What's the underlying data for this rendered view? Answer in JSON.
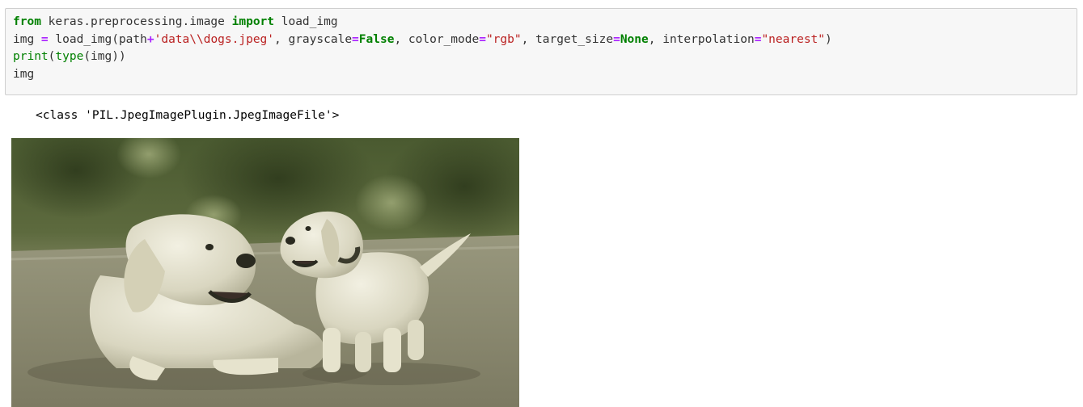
{
  "code_cell": {
    "line1": {
      "kw_from": "from",
      "module": " keras.preprocessing.image ",
      "kw_import": "import",
      "name": " load_img"
    },
    "line2": {
      "lhs": "img ",
      "eq": "=",
      "call": " load_img(path",
      "plus": "+",
      "path_str": "'data\\\\dogs.jpeg'",
      "arg1": ", grayscale",
      "eq1": "=",
      "false": "False",
      "arg2": ", color_mode",
      "eq2": "=",
      "rgb": "\"rgb\"",
      "arg3": ", target_size",
      "eq3": "=",
      "none": "None",
      "arg4": ", interpolation",
      "eq4": "=",
      "nearest": "\"nearest\"",
      "close": ")"
    },
    "line3": {
      "print": "print",
      "open": "(",
      "type": "type",
      "rest": "(img))"
    },
    "line4": {
      "text": "img"
    }
  },
  "output": {
    "stdout": "<class 'PIL.JpegImagePlugin.JpegImageFile'>",
    "image_subject": "two white dogs (adult and puppy) on a road"
  },
  "colors": {
    "cell_background": "#f7f7f7",
    "cell_border": "#cfcfcf",
    "keyword": "#008000",
    "string": "#ba2121",
    "operator": "#aa22ff",
    "text": "#333333"
  }
}
